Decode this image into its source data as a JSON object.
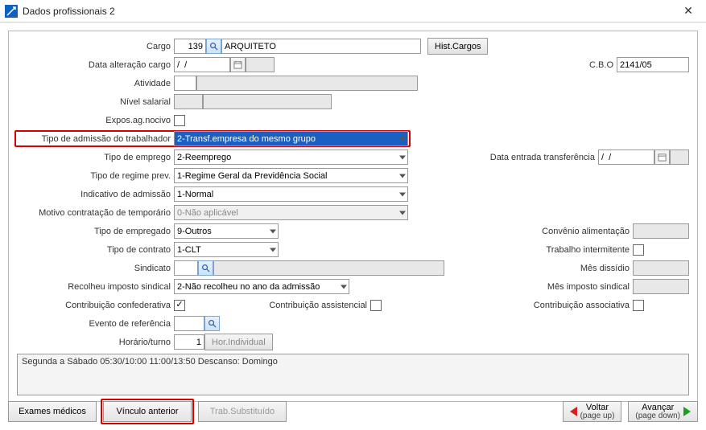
{
  "window": {
    "title": "Dados profissionais 2"
  },
  "labels": {
    "cargo": "Cargo",
    "data_alt_cargo": "Data alteração cargo",
    "atividade": "Atividade",
    "nivel_salarial": "Nível salarial",
    "expos_nocivo": "Expos.ag.nocivo",
    "tipo_admissao": "Tipo de admissão do trabalhador",
    "tipo_emprego": "Tipo de emprego",
    "tipo_regime": "Tipo de regime prev.",
    "indicativo": "Indicativo de admissão",
    "motivo_temp": "Motivo contratação de temporário",
    "tipo_empregado": "Tipo de empregado",
    "tipo_contrato": "Tipo de contrato",
    "sindicato": "Sindicato",
    "recolheu_imp": "Recolheu imposto sindical",
    "contrib_confed": "Contribuição confederativa",
    "contrib_assist": "Contribuição assistencial",
    "contrib_assoc": "Contribuição associativa",
    "evento_ref": "Evento de referência",
    "horario_turno": "Horário/turno",
    "btn_hist_cargos": "Hist.Cargos",
    "btn_hor_individual": "Hor.Individual",
    "cbo": "C.B.O",
    "data_transf": "Data entrada transferência",
    "conv_alim": "Convênio alimentação",
    "trab_interm": "Trabalho intermitente",
    "mes_dissidio": "Mês dissídio",
    "mes_imp_sind": "Mês imposto sindical"
  },
  "values": {
    "cargo_cod": "139",
    "cargo_desc": "ARQUITETO",
    "data_alt_cargo": "/  /",
    "cbo": "2141/05",
    "tipo_admissao": "2-Transf.empresa do mesmo grupo",
    "tipo_emprego": "2-Reemprego",
    "tipo_regime": "1-Regime Geral da Previdência Social",
    "indicativo": "1-Normal",
    "motivo_temp": "0-Não aplicável",
    "tipo_empregado": "9-Outros",
    "tipo_contrato": "1-CLT",
    "recolheu_imp": "2-Não recolheu no ano da admissão",
    "horario_turno": "1",
    "data_transf": "/  /",
    "schedule_text": "Segunda a Sábado 05:30/10:00 11:00/13:50 Descanso: Domingo"
  },
  "footer": {
    "exames": "Exames médicos",
    "vinculo": "Vínculo anterior",
    "trab_subst": "Trab.Substituído",
    "voltar": "Voltar",
    "voltar_sub": "(page up)",
    "avancar": "Avançar",
    "avancar_sub": "(page down)"
  }
}
